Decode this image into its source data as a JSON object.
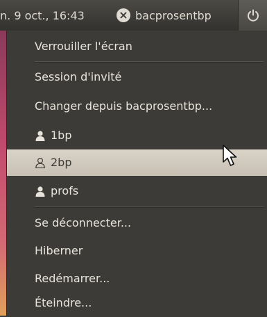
{
  "panel": {
    "clock": "n. 9 oct., 16:43",
    "username": "bacprosentbp"
  },
  "menu": {
    "lock_screen": "Verrouiller l'écran",
    "guest_session": "Session d'invité",
    "switch_from": "Changer depuis bacprosentbp...",
    "users": [
      {
        "label": "1bp",
        "selected": false
      },
      {
        "label": "2bp",
        "selected": true
      },
      {
        "label": "profs",
        "selected": false
      }
    ],
    "logout": "Se déconnecter...",
    "hibernate": "Hiberner",
    "restart": "Redémarrer...",
    "shutdown": "Éteindre..."
  },
  "icons": {
    "availability": "busy-x-icon",
    "power": "power-icon",
    "user": "user-icon",
    "cursor": "mouse-pointer-icon"
  },
  "colors": {
    "panel_bg": "#3c3b37",
    "selected_bg": "#d0c9bd",
    "menu_text": "#e8e4dc",
    "desktop_accent": "#c24a6e"
  }
}
